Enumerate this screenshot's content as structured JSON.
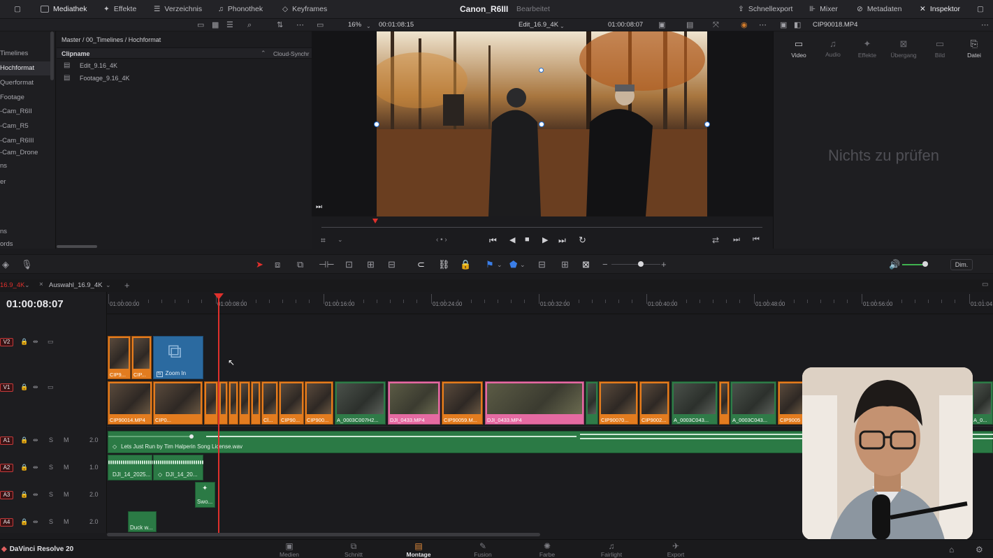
{
  "top_toolbar": {
    "mediathek": "Mediathek",
    "effekte": "Effekte",
    "verzeichnis": "Verzeichnis",
    "phonothek": "Phonothek",
    "keyframes": "Keyframes",
    "project_title": "Canon_R6III",
    "project_status": "Bearbeitet",
    "schnellexport": "Schnellexport",
    "mixer": "Mixer",
    "metadaten": "Metadaten",
    "inspektor": "Inspektor"
  },
  "sub_toolbar": {
    "zoom": "16%",
    "source_timecode": "00:01:08:15",
    "timeline_name": "Edit_16.9_4K",
    "record_timecode": "01:00:08:07",
    "clip_name": "CIP90018.MP4"
  },
  "left_nav": {
    "items": [
      "Timelines",
      "Hochformat",
      "Querformat",
      "Footage",
      "-Cam_R6II",
      "-Cam_R5",
      "-Cam_R6III",
      "-Cam_Drone"
    ],
    "lower_items": [
      "ns",
      "er",
      "ns",
      "ords"
    ]
  },
  "bin": {
    "breadcrumb": "Master / 00_Timelines / Hochformat",
    "col_clipname": "Clipname",
    "col_cloud": "Cloud-Synchr",
    "clips": [
      "Edit_9.16_4K",
      "Footage_9.16_4K"
    ]
  },
  "inspector": {
    "tabs": [
      "Video",
      "Audio",
      "Effekte",
      "Übergang",
      "Bild",
      "Datei"
    ],
    "empty_message": "Nichts zu prüfen"
  },
  "tool_row": {
    "dim_label": "Dim."
  },
  "timeline_tabs": {
    "active": "16.9_4K",
    "second": "Auswahl_16.9_4K"
  },
  "timeline": {
    "current_timecode": "01:00:08:07",
    "ruler_labels": [
      "01:00:00:00",
      "01:00:08:00",
      "01:00:16:00",
      "01:00:24:00",
      "01:00:32:00",
      "01:00:40:00",
      "01:00:48:00",
      "01:00:56:00",
      "01:01:04"
    ],
    "tracks": [
      {
        "id": "V2"
      },
      {
        "id": "V1"
      },
      {
        "id": "A1",
        "level": "2.0"
      },
      {
        "id": "A2",
        "level": "1.0"
      },
      {
        "id": "A3",
        "level": "2.0"
      },
      {
        "id": "A4",
        "level": "2.0"
      }
    ],
    "v2_clips": [
      "CIP9...",
      "CIP...",
      "Zoom In"
    ],
    "v1_clips": [
      "CIP90014.MP4",
      "CIP0...",
      "Cl...",
      "CIP90...",
      "CIP900...",
      "A_0003C007H2...",
      "DJI_0433.MP4",
      "CIP90059.M...",
      "DJI_0433.MP4",
      "CIP90070...",
      "CIP9002...",
      "A_0003C043...",
      "A_0003C043...",
      "CIP9005",
      "A_0..."
    ],
    "a1_clip": "Lets Just Run by Tim Halperin Song License.wav",
    "a2_clips": [
      "DJI_14_2025...",
      "DJI_14_20..."
    ],
    "a3_clip": "Swo...",
    "a4_clip": "Duck w..."
  },
  "bottom_nav": {
    "app_name": "DaVinci Resolve 20",
    "pages": [
      "Medien",
      "Schnitt",
      "Montage",
      "Fusion",
      "Farbe",
      "Fairlight",
      "Export"
    ],
    "active_page": "Montage"
  },
  "colors": {
    "accent_orange": "#e37c1f",
    "accent_pink": "#e56aa2",
    "track_green": "#2f7b48",
    "audio_green": "#2b7a45",
    "playhead_red": "#e0302c",
    "selection_blue": "#1e6fd8"
  }
}
